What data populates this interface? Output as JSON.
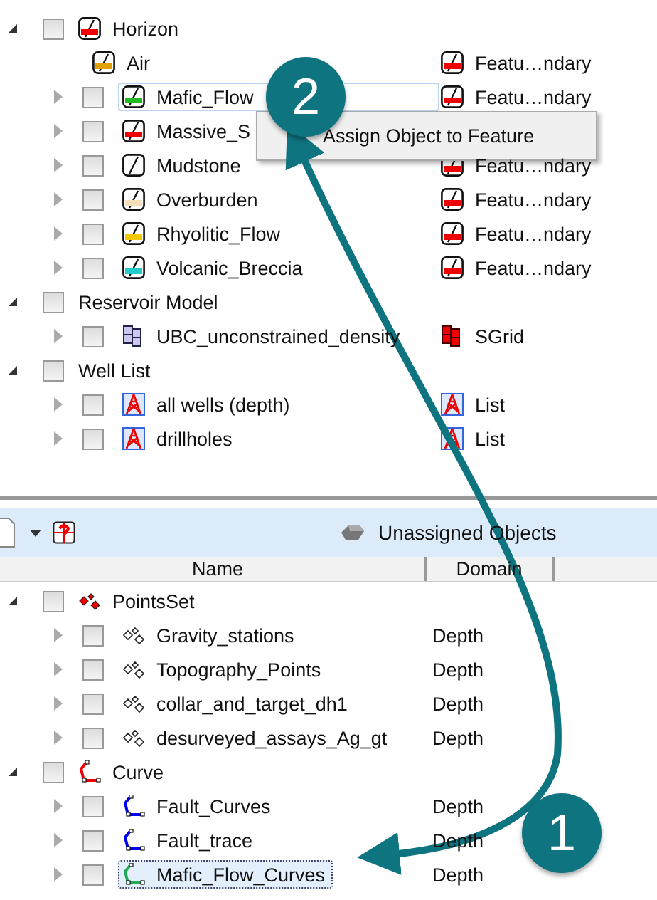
{
  "top_tree": [
    {
      "label": "Horizon",
      "kind": "horizon",
      "color": "#ee0000",
      "expanded": true,
      "checked": false,
      "children": [
        {
          "label": "Air",
          "kind": "horizon",
          "color": "#e0a000",
          "selected": false,
          "type": {
            "label": "Featu…ndary",
            "kind": "horizon"
          }
        },
        {
          "label": "Mafic_Flow",
          "kind": "horizon",
          "color": "#22bb22",
          "expanded": false,
          "checked": false,
          "selected": true,
          "type": {
            "label": "Featu…ndary",
            "kind": "horizon"
          }
        },
        {
          "label": "Massive_S",
          "kind": "horizon",
          "color": "#ee0000",
          "expanded": false,
          "checked": false,
          "selected": false
        },
        {
          "label": "Mudstone",
          "kind": "horizon",
          "expanded": false,
          "checked": false,
          "selected": false,
          "type": {
            "label": "Featu…ndary",
            "kind": "horizon"
          }
        },
        {
          "label": "Overburden",
          "kind": "horizon",
          "color": "#f5dfb8",
          "expanded": false,
          "checked": false,
          "selected": false,
          "type": {
            "label": "Featu…ndary",
            "kind": "horizon"
          }
        },
        {
          "label": "Rhyolitic_Flow",
          "kind": "horizon",
          "color": "#f5c800",
          "expanded": false,
          "checked": false,
          "selected": false,
          "type": {
            "label": "Featu…ndary",
            "kind": "horizon"
          }
        },
        {
          "label": "Volcanic_Breccia",
          "kind": "horizon",
          "color": "#22cccc",
          "expanded": false,
          "checked": false,
          "selected": false,
          "type": {
            "label": "Featu…ndary",
            "kind": "horizon"
          }
        }
      ]
    },
    {
      "label": "Reservoir Model",
      "expanded": true,
      "checked": false,
      "children": [
        {
          "label": "UBC_unconstrained_density",
          "kind": "grid",
          "expanded": false,
          "checked": false,
          "selected": false,
          "type": {
            "label": "SGrid",
            "kind": "grid"
          }
        }
      ]
    },
    {
      "label": "Well List",
      "expanded": true,
      "checked": false,
      "children": [
        {
          "label": "all wells (depth)",
          "kind": "well",
          "expanded": false,
          "checked": false,
          "selected": false,
          "type": {
            "label": "List",
            "kind": "well"
          }
        },
        {
          "label": "drillholes",
          "kind": "well",
          "expanded": false,
          "checked": false,
          "selected": false,
          "type": {
            "label": "List",
            "kind": "well"
          }
        }
      ]
    }
  ],
  "context_menu": {
    "items": [
      "Assign Object to Feature"
    ]
  },
  "lower_panel": {
    "title": "Unassigned Objects",
    "columns": [
      "Name",
      "Domain"
    ],
    "tree": [
      {
        "label": "PointsSet",
        "kind": "points",
        "expanded": true,
        "checked": false,
        "children": [
          {
            "label": "Gravity_stations",
            "kind": "points",
            "expanded": false,
            "checked": false,
            "selected": false,
            "domain": "Depth"
          },
          {
            "label": "Topography_Points",
            "kind": "points",
            "expanded": false,
            "checked": false,
            "selected": false,
            "domain": "Depth"
          },
          {
            "label": "collar_and_target_dh1",
            "kind": "points",
            "expanded": false,
            "checked": false,
            "selected": false,
            "domain": "Depth"
          },
          {
            "label": "desurveyed_assays_Ag_gt",
            "kind": "points",
            "expanded": false,
            "checked": false,
            "selected": false,
            "domain": "Depth"
          }
        ]
      },
      {
        "label": "Curve",
        "kind": "curve",
        "color": "#ee0000",
        "expanded": true,
        "checked": false,
        "children": [
          {
            "label": "Fault_Curves",
            "kind": "curve",
            "color": "#0000ee",
            "expanded": false,
            "checked": false,
            "selected": false,
            "domain": "Depth"
          },
          {
            "label": "Fault_trace",
            "kind": "curve",
            "color": "#0000ee",
            "expanded": false,
            "checked": false,
            "selected": false,
            "domain": "Depth"
          },
          {
            "label": "Mafic_Flow_Curves",
            "kind": "curve",
            "color": "#22aa55",
            "expanded": false,
            "checked": false,
            "selected": true,
            "domain": "Depth"
          }
        ]
      }
    ]
  },
  "callouts": [
    "2",
    "1"
  ]
}
